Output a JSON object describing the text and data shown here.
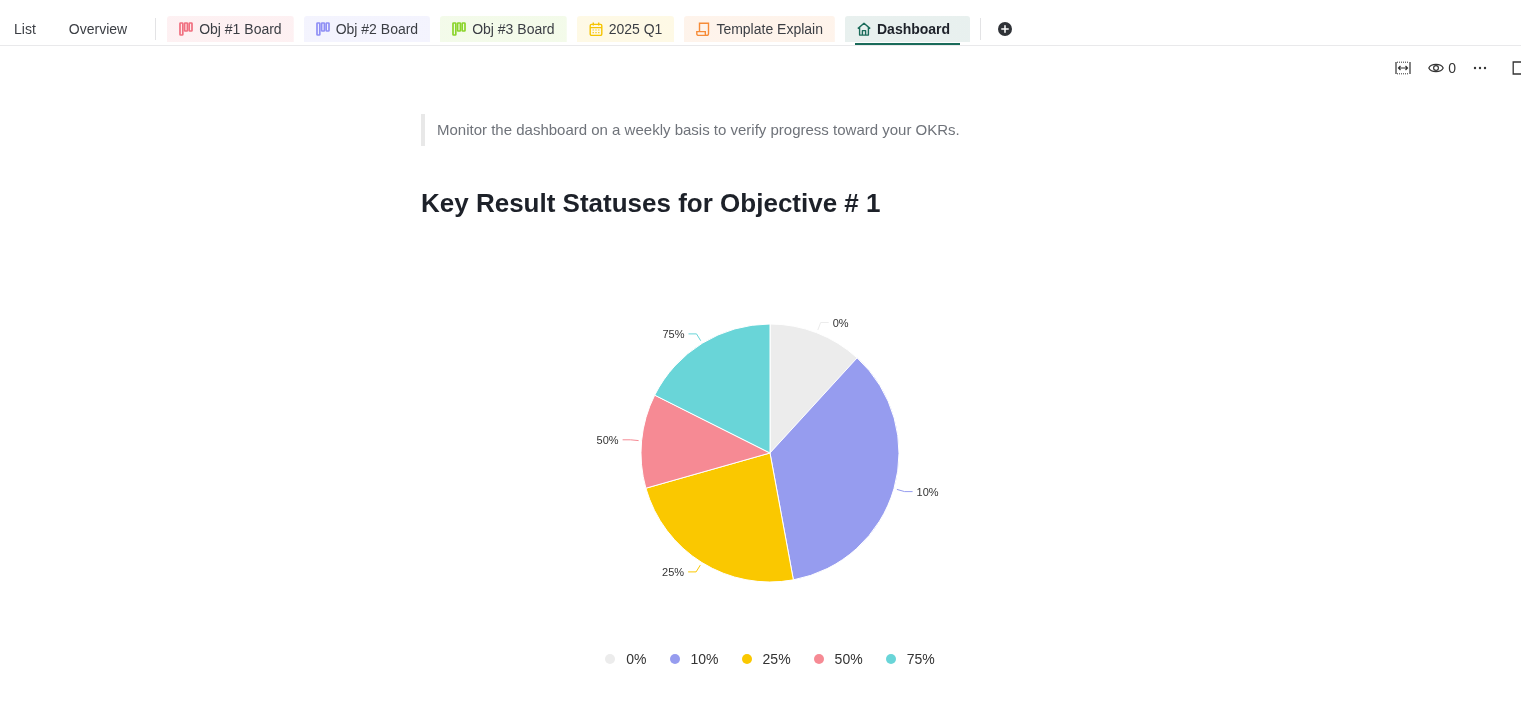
{
  "tabs": [
    {
      "label": "List",
      "kind": "plain",
      "selected": false
    },
    {
      "label": "Overview",
      "kind": "plain",
      "selected": false
    },
    {
      "label": "Obj #1 Board",
      "kind": "board",
      "color": "#f06f7f",
      "selected": false
    },
    {
      "label": "Obj #2 Board",
      "kind": "board",
      "color": "#8f8ff5",
      "selected": false
    },
    {
      "label": "Obj #3 Board",
      "kind": "board",
      "color": "#8ad42a",
      "selected": false
    },
    {
      "label": "2025 Q1",
      "kind": "calendar",
      "color": "#f5c400",
      "selected": false
    },
    {
      "label": "Template Explain",
      "kind": "document",
      "color": "#f68c38",
      "selected": false
    },
    {
      "label": "Dashboard",
      "kind": "home",
      "color": "#1a6b5a",
      "selected": true
    }
  ],
  "toolbar": {
    "view_count": "0"
  },
  "quote": "Monitor the dashboard on a weekly basis to verify progress toward your OKRs.",
  "heading": "Key Result Statuses for Objective # 1",
  "chart": {
    "chart_data": {
      "type": "pie",
      "categories": [
        "0%",
        "10%",
        "25%",
        "50%",
        "75%"
      ],
      "values": [
        11.8,
        35.3,
        23.5,
        11.8,
        17.6
      ]
    },
    "legend": [
      {
        "label": "0%",
        "color": "#ececec"
      },
      {
        "label": "10%",
        "color": "#969cef"
      },
      {
        "label": "25%",
        "color": "#fac800"
      },
      {
        "label": "50%",
        "color": "#f68a94"
      },
      {
        "label": "75%",
        "color": "#69d5d8"
      }
    ]
  }
}
